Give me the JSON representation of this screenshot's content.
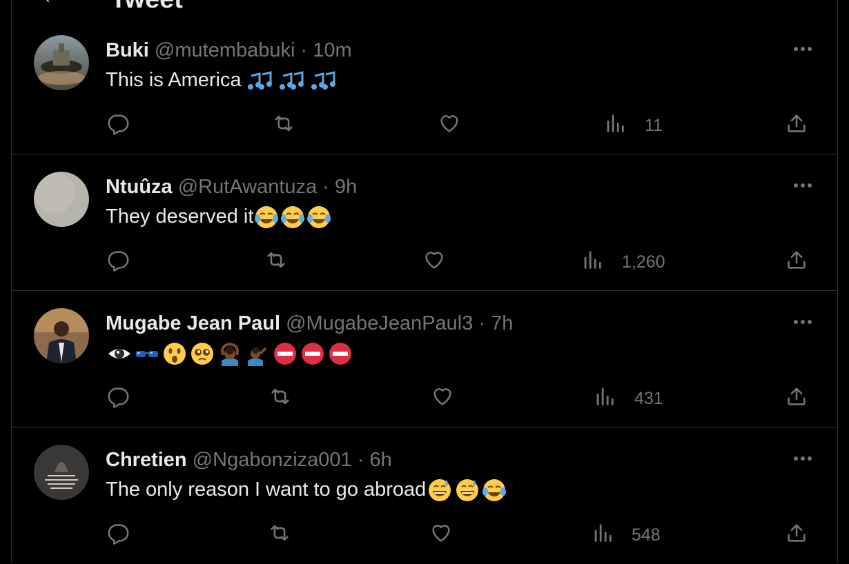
{
  "header": {
    "title": "Tweet"
  },
  "tweets": [
    {
      "name": "Buki",
      "handle": "@mutembabuki",
      "separator": "·",
      "time": "10m",
      "text": "This is America",
      "emojis": [
        "music-notes",
        "music-notes",
        "music-notes"
      ],
      "views": "11"
    },
    {
      "name": "Ntuûza",
      "handle": "@RutAwantuza",
      "separator": "·",
      "time": "9h",
      "text": "They deserved it",
      "emojis": [
        "tears-of-joy",
        "tears-of-joy",
        "tears-of-joy"
      ],
      "views": "1,260"
    },
    {
      "name": "Mugabe Jean Paul",
      "handle": "@MugabeJeanPaul3",
      "separator": "·",
      "time": "7h",
      "text": "",
      "emojis": [
        "eye",
        "sunglasses",
        "astonished",
        "pleading",
        "person-gesturing-ok",
        "person-facepalming",
        "no-entry",
        "no-entry",
        "no-entry"
      ],
      "views": "431"
    },
    {
      "name": "Chretien",
      "handle": "@Ngabonziza001",
      "separator": "·",
      "time": "6h",
      "text": "The only reason I want to go abroad",
      "emojis": [
        "grinning-sweat",
        "grinning-sweat",
        "tears-of-joy"
      ],
      "views": "548"
    }
  ],
  "colors": {
    "background": "#000000",
    "text": "#e7e9ea",
    "muted": "#71767b",
    "divider": "#2f3336"
  }
}
